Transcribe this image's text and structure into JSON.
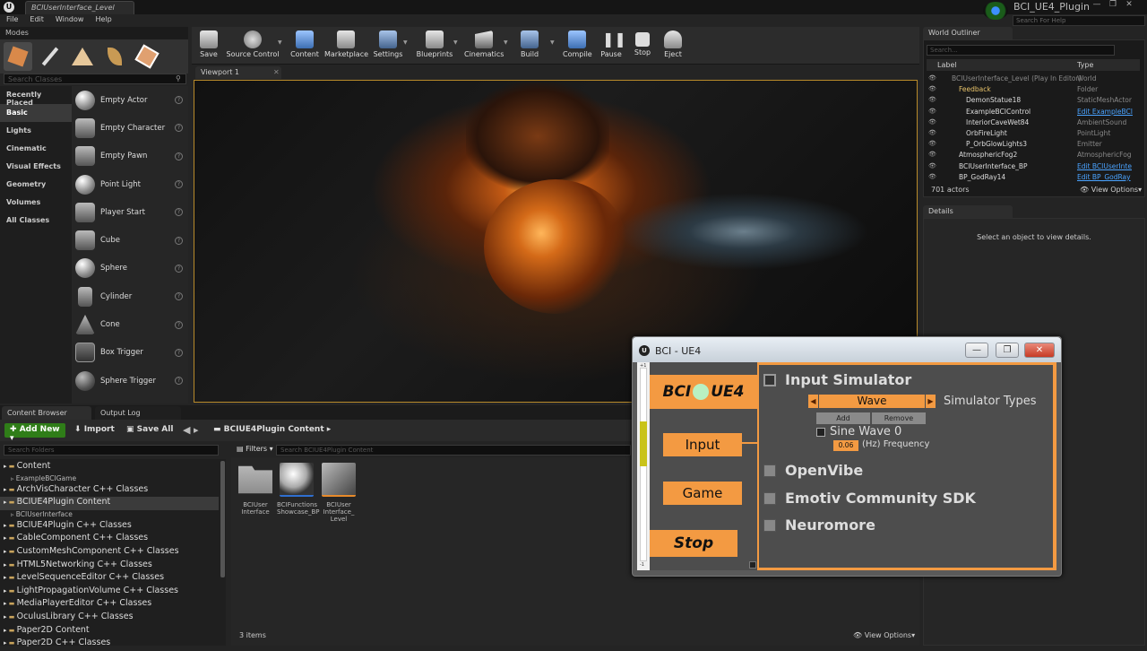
{
  "app": {
    "doc_tab": "BCIUserInterface_Level",
    "project_name": "BCI_UE4_Plugin",
    "help_search_placeholder": "Search For Help",
    "window_buttons": [
      "—",
      "❐",
      "✕"
    ]
  },
  "menu": [
    "File",
    "Edit",
    "Window",
    "Help"
  ],
  "modes": {
    "tab": "Modes",
    "search_placeholder": "Search Classes",
    "categories": [
      "Recently Placed",
      "Basic",
      "Lights",
      "Cinematic",
      "Visual Effects",
      "Geometry",
      "Volumes",
      "All Classes"
    ],
    "selected_category": "Basic",
    "actors": [
      "Empty Actor",
      "Empty Character",
      "Empty Pawn",
      "Point Light",
      "Player Start",
      "Cube",
      "Sphere",
      "Cylinder",
      "Cone",
      "Box Trigger",
      "Sphere Trigger"
    ]
  },
  "toolbar": {
    "save": "Save",
    "source_control": "Source Control",
    "content": "Content",
    "marketplace": "Marketplace",
    "settings": "Settings",
    "blueprints": "Blueprints",
    "cinematics": "Cinematics",
    "build": "Build",
    "compile": "Compile",
    "pause": "Pause",
    "stop": "Stop",
    "eject": "Eject"
  },
  "viewport": {
    "tab": "Viewport 1"
  },
  "world_outliner": {
    "tab": "World Outliner",
    "search_placeholder": "Search...",
    "col_label": "Label",
    "col_type": "Type",
    "rows": [
      {
        "label": "BCIUserInterface_Level (Play In Editor)",
        "type": "World",
        "link": false
      },
      {
        "label": "Feedback",
        "type": "Folder",
        "link": false
      },
      {
        "label": "DemonStatue18",
        "type": "StaticMeshActor",
        "link": false
      },
      {
        "label": "ExampleBCIControl",
        "type": "Edit ExampleBCI",
        "link": true
      },
      {
        "label": "InteriorCaveWet84",
        "type": "AmbientSound",
        "link": false
      },
      {
        "label": "OrbFireLight",
        "type": "PointLight",
        "link": false
      },
      {
        "label": "P_OrbGlowLights3",
        "type": "Emitter",
        "link": false
      },
      {
        "label": "AtmosphericFog2",
        "type": "AtmosphericFog",
        "link": false
      },
      {
        "label": "BCIUserInterface_BP",
        "type": "Edit BCIUserInte",
        "link": true
      },
      {
        "label": "BP_GodRay14",
        "type": "Edit BP_GodRay",
        "link": true
      }
    ],
    "actor_count": "701 actors",
    "view_options": "View Options"
  },
  "details": {
    "tab": "Details",
    "message": "Select an object to view details."
  },
  "content_browser": {
    "tabs": [
      "Content Browser",
      "Output Log"
    ],
    "add_new": "Add New",
    "import": "Import",
    "save_all": "Save All",
    "path": "BCIUE4Plugin Content",
    "folder_search_placeholder": "Search Folders",
    "filters": "Filters",
    "asset_search_placeholder": "Search BCIUE4Plugin Content",
    "tree": [
      {
        "label": "Content",
        "small": false,
        "selected": false
      },
      {
        "label": "ExampleBCIGame",
        "small": true,
        "selected": false
      },
      {
        "label": "ArchVisCharacter C++ Classes",
        "small": false,
        "selected": false
      },
      {
        "label": "BCIUE4Plugin Content",
        "small": false,
        "selected": true
      },
      {
        "label": "BCIUserInterface",
        "small": true,
        "selected": false
      },
      {
        "label": "BCIUE4Plugin C++ Classes",
        "small": false,
        "selected": false
      },
      {
        "label": "CableComponent C++ Classes",
        "small": false,
        "selected": false
      },
      {
        "label": "CustomMeshComponent C++ Classes",
        "small": false,
        "selected": false
      },
      {
        "label": "HTML5Networking C++ Classes",
        "small": false,
        "selected": false
      },
      {
        "label": "LevelSequenceEditor C++ Classes",
        "small": false,
        "selected": false
      },
      {
        "label": "LightPropagationVolume C++ Classes",
        "small": false,
        "selected": false
      },
      {
        "label": "MediaPlayerEditor C++ Classes",
        "small": false,
        "selected": false
      },
      {
        "label": "OculusLibrary C++ Classes",
        "small": false,
        "selected": false
      },
      {
        "label": "Paper2D Content",
        "small": false,
        "selected": false
      },
      {
        "label": "Paper2D C++ Classes",
        "small": false,
        "selected": false
      }
    ],
    "assets": [
      {
        "label": "BCIUser Interface",
        "kind": "folder"
      },
      {
        "label": "BCIFunctions Showcase_BP",
        "kind": "material"
      },
      {
        "label": "BCIUser Interface_ Level",
        "kind": "level"
      }
    ],
    "item_count": "3 items",
    "view_options": "View Options"
  },
  "bci_window": {
    "title": "BCI - UE4",
    "logo_left": "BCI",
    "logo_right": "UE4",
    "nav": {
      "input": "Input",
      "game": "Game",
      "stop": "Stop"
    },
    "slider_top": "+1",
    "slider_bottom": "-1",
    "options": {
      "input_simulator": "Input Simulator",
      "openvibe": "OpenVibe",
      "emotiv": "Emotiv Community SDK",
      "neuromore": "Neuromore"
    },
    "simulator_selected": "Wave",
    "simulator_types_label": "Simulator Types",
    "add_button": "Add",
    "remove_button": "Remove",
    "sine_wave_label": "Sine Wave 0",
    "frequency_value": "0.06",
    "frequency_label": "(Hz) Frequency",
    "accent_color": "#f39a42"
  }
}
